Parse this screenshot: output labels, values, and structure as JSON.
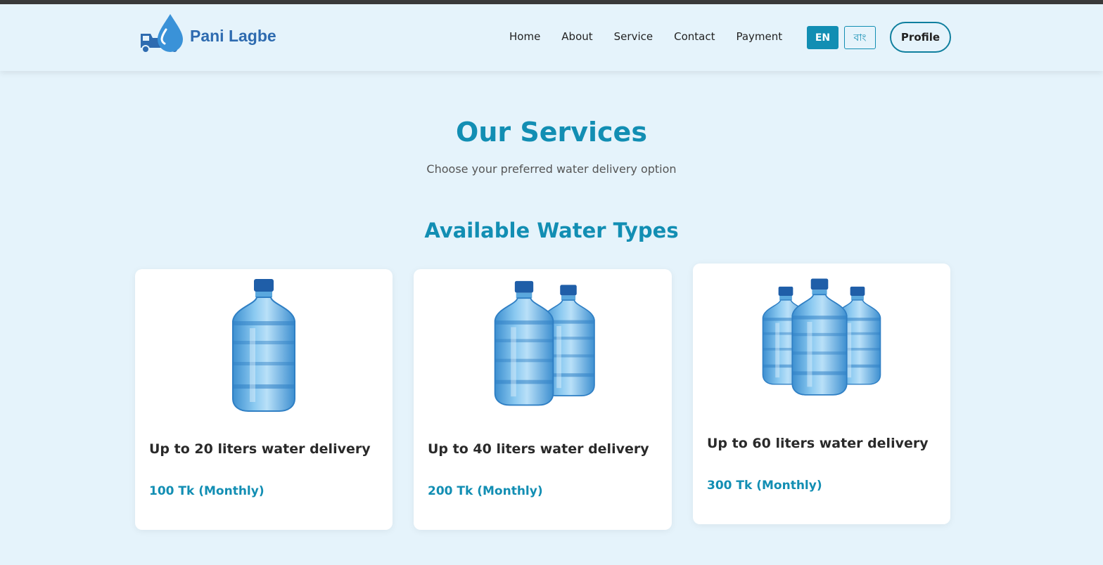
{
  "brand": {
    "name": "Pani Lagbe"
  },
  "nav": {
    "items": [
      {
        "label": "Home"
      },
      {
        "label": "About"
      },
      {
        "label": "Service"
      },
      {
        "label": "Contact"
      },
      {
        "label": "Payment"
      }
    ],
    "lang_en": "EN",
    "lang_bn": "বাং",
    "profile": "Profile"
  },
  "page": {
    "title": "Our Services",
    "subtitle": "Choose your preferred water delivery option",
    "section_title": "Available Water Types"
  },
  "cards": [
    {
      "name": "Up to 20 liters water delivery",
      "price": "100 Tk (Monthly)",
      "bottles": 1
    },
    {
      "name": "Up to 40 liters water delivery",
      "price": "200 Tk (Monthly)",
      "bottles": 2
    },
    {
      "name": "Up to 60 liters water delivery",
      "price": "300 Tk (Monthly)",
      "bottles": 3
    }
  ],
  "colors": {
    "accent": "#128eb3",
    "background": "#e5f3fb",
    "logo": "#2e6bb0",
    "bottle": "#5aa8de"
  }
}
